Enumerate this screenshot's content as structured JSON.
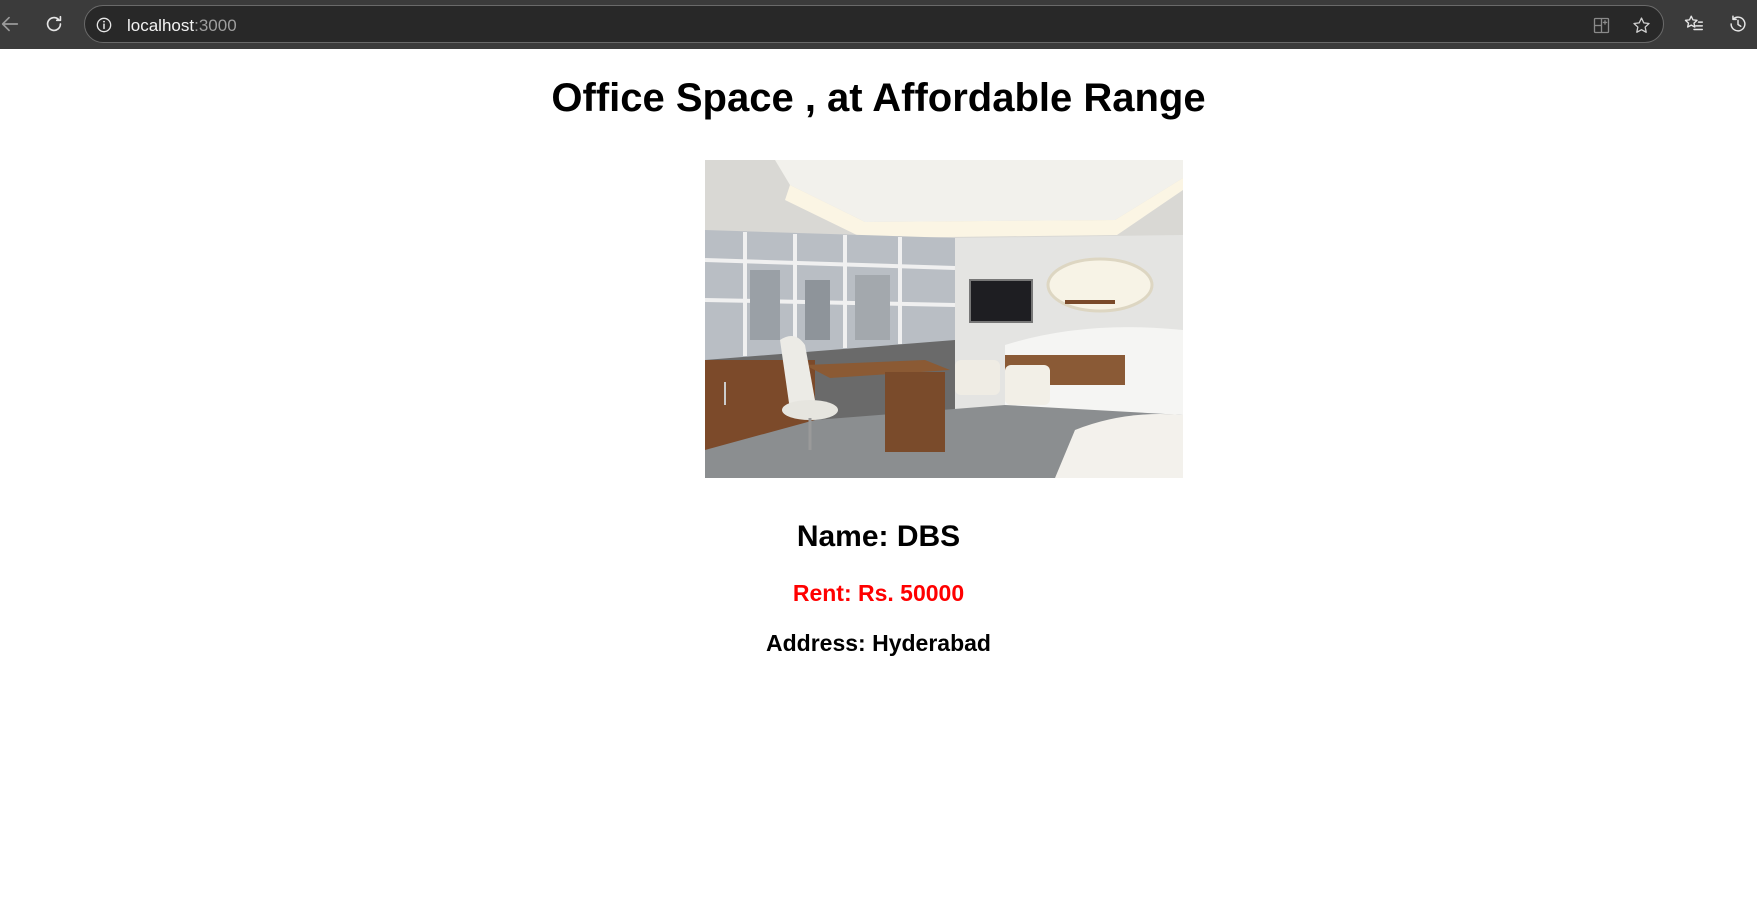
{
  "browser": {
    "url_host": "localhost",
    "url_port": ":3000",
    "icons": {
      "back": "back-arrow-icon",
      "reload": "reload-icon",
      "site_info": "info-icon",
      "apps": "apps-icon",
      "favorite": "star-icon",
      "favorites_list": "favorites-icon",
      "history": "history-icon"
    }
  },
  "page": {
    "title": "Office Space , at Affordable Range",
    "name": "Name: DBS",
    "rent": "Rent: Rs. 50000",
    "address": "Address: Hyderabad"
  },
  "colors": {
    "rent": "#ff0000",
    "toolbar": "#3b3b3b",
    "omnibox": "#282828"
  }
}
